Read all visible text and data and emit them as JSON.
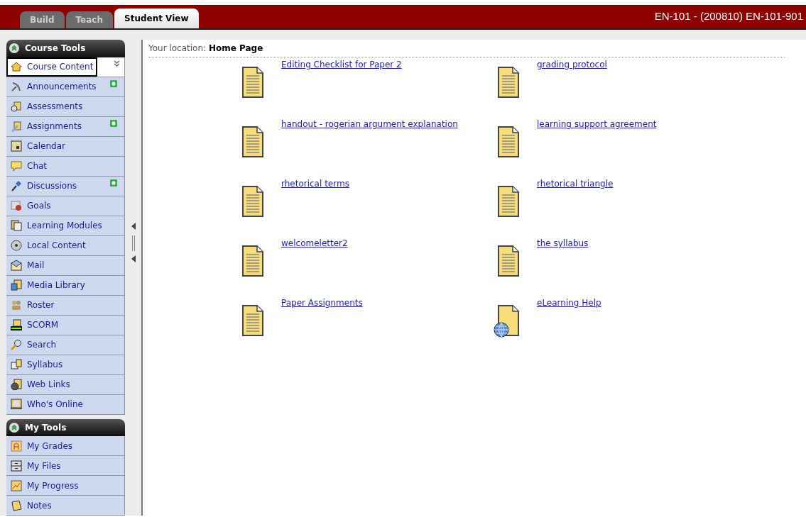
{
  "tabs": [
    {
      "label": "Build",
      "selected": false
    },
    {
      "label": "Teach",
      "selected": false
    },
    {
      "label": "Student View",
      "selected": true
    }
  ],
  "course_title": "EN-101 - (200810) EN-101-901",
  "sidebar": {
    "sections": [
      {
        "title": "Course Tools",
        "expanded": true,
        "items": [
          {
            "label": "Course Content",
            "selected": true,
            "new": false
          },
          {
            "label": "Announcements",
            "selected": false,
            "new": true
          },
          {
            "label": "Assessments",
            "selected": false,
            "new": false
          },
          {
            "label": "Assignments",
            "selected": false,
            "new": true
          },
          {
            "label": "Calendar",
            "selected": false,
            "new": false
          },
          {
            "label": "Chat",
            "selected": false,
            "new": false
          },
          {
            "label": "Discussions",
            "selected": false,
            "new": true
          },
          {
            "label": "Goals",
            "selected": false,
            "new": false
          },
          {
            "label": "Learning Modules",
            "selected": false,
            "new": false
          },
          {
            "label": "Local Content",
            "selected": false,
            "new": false
          },
          {
            "label": "Mail",
            "selected": false,
            "new": false
          },
          {
            "label": "Media Library",
            "selected": false,
            "new": false
          },
          {
            "label": "Roster",
            "selected": false,
            "new": false
          },
          {
            "label": "SCORM",
            "selected": false,
            "new": false
          },
          {
            "label": "Search",
            "selected": false,
            "new": false
          },
          {
            "label": "Syllabus",
            "selected": false,
            "new": false
          },
          {
            "label": "Web Links",
            "selected": false,
            "new": false
          },
          {
            "label": "Who's Online",
            "selected": false,
            "new": false
          }
        ]
      },
      {
        "title": "My Tools",
        "expanded": true,
        "items": [
          {
            "label": "My Grades",
            "selected": false,
            "new": false
          },
          {
            "label": "My Files",
            "selected": false,
            "new": false
          },
          {
            "label": "My Progress",
            "selected": false,
            "new": false
          },
          {
            "label": "Notes",
            "selected": false,
            "new": false
          }
        ]
      }
    ]
  },
  "breadcrumb": {
    "label": "Your location:",
    "current": "Home Page"
  },
  "files": [
    {
      "title": "Editing Checklist for Paper 2",
      "kind": "document"
    },
    {
      "title": "grading protocol",
      "kind": "document"
    },
    {
      "title": "handout - rogerian argument explanation",
      "kind": "document"
    },
    {
      "title": "learning support agreement",
      "kind": "document"
    },
    {
      "title": "rhetorical terms",
      "kind": "document"
    },
    {
      "title": "rhetorical triangle",
      "kind": "document"
    },
    {
      "title": "welcomeletter2",
      "kind": "document"
    },
    {
      "title": "the syllabus",
      "kind": "document"
    },
    {
      "title": "Paper Assignments",
      "kind": "document"
    },
    {
      "title": "eLearning Help",
      "kind": "web"
    }
  ]
}
